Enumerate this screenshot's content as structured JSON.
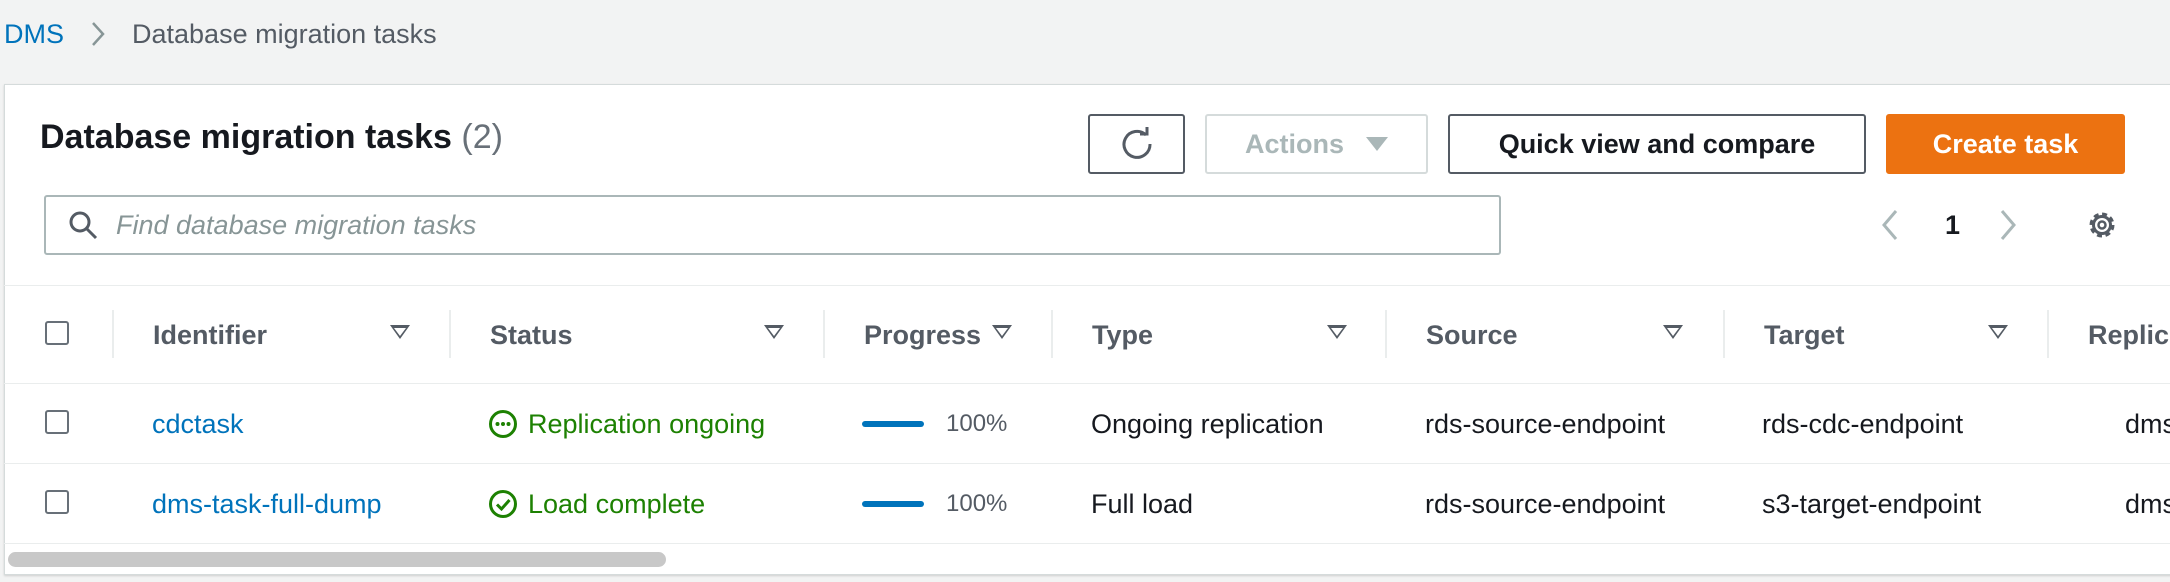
{
  "breadcrumb": {
    "root": "DMS",
    "current": "Database migration tasks"
  },
  "panel": {
    "title": "Database migration tasks",
    "count": "(2)",
    "buttons": {
      "actions": "Actions",
      "quick_view": "Quick view and compare",
      "create": "Create task"
    },
    "search_placeholder": "Find database migration tasks",
    "page": "1"
  },
  "table": {
    "columns": [
      "Identifier",
      "Status",
      "Progress",
      "Type",
      "Source",
      "Target",
      "Replic"
    ],
    "rows": [
      {
        "identifier": "cdctask",
        "status": "Replication ongoing",
        "status_icon": "ellipsis-circle-icon",
        "progress": "100%",
        "type": "Ongoing replication",
        "source": "rds-source-endpoint",
        "target": "rds-cdc-endpoint",
        "replication": "dmsre"
      },
      {
        "identifier": "dms-task-full-dump",
        "status": "Load complete",
        "status_icon": "check-circle-icon",
        "progress": "100%",
        "type": "Full load",
        "source": "rds-source-endpoint",
        "target": "s3-target-endpoint",
        "replication": "dmsre"
      }
    ]
  },
  "colors": {
    "link": "#0073bb",
    "primary": "#ec7211",
    "success": "#1d8102"
  }
}
